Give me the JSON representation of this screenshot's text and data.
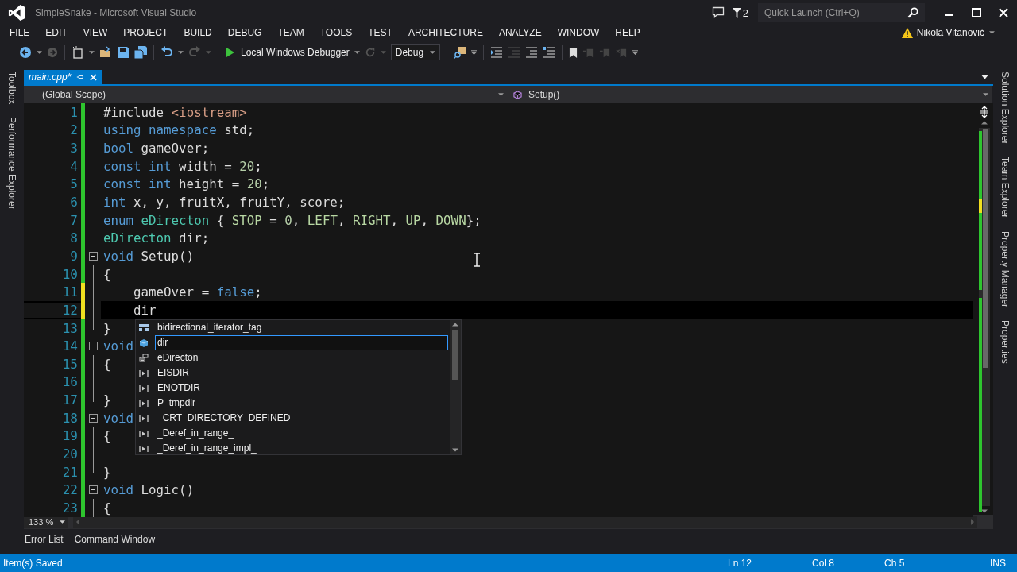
{
  "window": {
    "title": "SimpleSnake - Microsoft Visual Studio"
  },
  "title_bar": {
    "notification_count": "2",
    "quick_launch": {
      "placeholder": "Quick Launch (Ctrl+Q)"
    }
  },
  "menu": [
    {
      "label": "FILE"
    },
    {
      "label": "EDIT"
    },
    {
      "label": "VIEW"
    },
    {
      "label": "PROJECT"
    },
    {
      "label": "BUILD"
    },
    {
      "label": "DEBUG"
    },
    {
      "label": "TEAM"
    },
    {
      "label": "TOOLS"
    },
    {
      "label": "TEST"
    },
    {
      "label": "ARCHITECTURE"
    },
    {
      "label": "ANALYZE"
    },
    {
      "label": "WINDOW"
    },
    {
      "label": "HELP"
    }
  ],
  "account": {
    "name": "Nikola Vitanović"
  },
  "toolbar": {
    "debugger": "Local Windows Debugger",
    "configuration": "Debug"
  },
  "left_panel_tabs": [
    {
      "label": "Toolbox"
    },
    {
      "label": "Performance Explorer"
    }
  ],
  "right_panel_tabs": [
    {
      "label": "Solution Explorer"
    },
    {
      "label": "Team Explorer"
    },
    {
      "label": "Property Manager"
    },
    {
      "label": "Properties"
    }
  ],
  "document_tabs": [
    {
      "label": "main.cpp*",
      "selected": true
    }
  ],
  "navigation_bar": {
    "scope": "(Global Scope)",
    "member": "Setup()"
  },
  "editor": {
    "zoom": "133 %",
    "lines": [
      {
        "number": "1",
        "modified": false,
        "kind": "plain",
        "current": false,
        "tokens": [
          {
            "text": "#include ",
            "kind": "plain"
          },
          {
            "text": "<iostream>",
            "kind": "string"
          }
        ]
      },
      {
        "number": "2",
        "modified": false,
        "kind": "plain",
        "current": false,
        "tokens": [
          {
            "text": "using namespace ",
            "kind": "keyword"
          },
          {
            "text": "std;",
            "kind": "plain"
          }
        ]
      },
      {
        "number": "3",
        "modified": false,
        "kind": "plain",
        "current": false,
        "tokens": [
          {
            "text": "bool ",
            "kind": "keyword"
          },
          {
            "text": "gameOver;",
            "kind": "plain"
          }
        ]
      },
      {
        "number": "4",
        "modified": false,
        "kind": "plain",
        "current": false,
        "tokens": [
          {
            "text": "const int ",
            "kind": "keyword"
          },
          {
            "text": "width = ",
            "kind": "plain"
          },
          {
            "text": "20",
            "kind": "number"
          },
          {
            "text": ";",
            "kind": "plain"
          }
        ]
      },
      {
        "number": "5",
        "modified": false,
        "kind": "plain",
        "current": false,
        "tokens": [
          {
            "text": "const int ",
            "kind": "keyword"
          },
          {
            "text": "height = ",
            "kind": "plain"
          },
          {
            "text": "20",
            "kind": "number"
          },
          {
            "text": ";",
            "kind": "plain"
          }
        ]
      },
      {
        "number": "6",
        "modified": false,
        "kind": "plain",
        "current": false,
        "tokens": [
          {
            "text": "int ",
            "kind": "keyword"
          },
          {
            "text": "x, y, fruitX, fruitY, score;",
            "kind": "plain"
          }
        ]
      },
      {
        "number": "7",
        "modified": false,
        "kind": "plain",
        "current": false,
        "tokens": [
          {
            "text": "enum ",
            "kind": "keyword"
          },
          {
            "text": "eDirecton",
            "kind": "type"
          },
          {
            "text": " { ",
            "kind": "plain"
          },
          {
            "text": "STOP",
            "kind": "enumerator"
          },
          {
            "text": " = ",
            "kind": "plain"
          },
          {
            "text": "0",
            "kind": "number"
          },
          {
            "text": ", ",
            "kind": "plain"
          },
          {
            "text": "LEFT",
            "kind": "enumerator"
          },
          {
            "text": ", ",
            "kind": "plain"
          },
          {
            "text": "RIGHT",
            "kind": "enumerator"
          },
          {
            "text": ", ",
            "kind": "plain"
          },
          {
            "text": "UP",
            "kind": "enumerator"
          },
          {
            "text": ", ",
            "kind": "plain"
          },
          {
            "text": "DOWN",
            "kind": "enumerator"
          },
          {
            "text": "};",
            "kind": "plain"
          }
        ]
      },
      {
        "number": "8",
        "modified": false,
        "kind": "plain",
        "current": false,
        "tokens": [
          {
            "text": "eDirecton",
            "kind": "type"
          },
          {
            "text": " dir;",
            "kind": "plain"
          }
        ]
      },
      {
        "number": "9",
        "modified": false,
        "kind": "block_start",
        "current": false,
        "tokens": [
          {
            "text": "void ",
            "kind": "keyword"
          },
          {
            "text": "Setup()",
            "kind": "plain"
          }
        ]
      },
      {
        "number": "10",
        "modified": false,
        "kind": "block_body",
        "current": false,
        "tokens": [
          {
            "text": "{",
            "kind": "plain"
          }
        ]
      },
      {
        "number": "11",
        "modified": true,
        "kind": "block_body",
        "current": false,
        "tokens": [
          {
            "text": "    gameOver = ",
            "kind": "plain"
          },
          {
            "text": "false",
            "kind": "keyword"
          },
          {
            "text": ";",
            "kind": "plain"
          }
        ]
      },
      {
        "number": "12",
        "modified": true,
        "kind": "block_body",
        "current": true,
        "tokens": [
          {
            "text": "    dir",
            "kind": "plain"
          }
        ]
      },
      {
        "number": "13",
        "modified": false,
        "kind": "block_end",
        "current": false,
        "tokens": [
          {
            "text": "}",
            "kind": "plain"
          }
        ]
      },
      {
        "number": "14",
        "modified": false,
        "kind": "block_start",
        "current": false,
        "tokens": [
          {
            "text": "void",
            "kind": "keyword"
          }
        ]
      },
      {
        "number": "15",
        "modified": false,
        "kind": "block_body",
        "current": false,
        "tokens": [
          {
            "text": "{",
            "kind": "plain"
          }
        ]
      },
      {
        "number": "16",
        "modified": false,
        "kind": "block_body",
        "current": false
      },
      {
        "number": "17",
        "modified": false,
        "kind": "block_end",
        "current": false,
        "tokens": [
          {
            "text": "}",
            "kind": "plain"
          }
        ]
      },
      {
        "number": "18",
        "modified": false,
        "kind": "block_start",
        "current": false,
        "tokens": [
          {
            "text": "void",
            "kind": "keyword"
          }
        ]
      },
      {
        "number": "19",
        "modified": false,
        "kind": "block_body",
        "current": false,
        "tokens": [
          {
            "text": "{",
            "kind": "plain"
          }
        ]
      },
      {
        "number": "20",
        "modified": false,
        "kind": "block_body",
        "current": false
      },
      {
        "number": "21",
        "modified": false,
        "kind": "block_end",
        "current": false,
        "tokens": [
          {
            "text": "}",
            "kind": "plain"
          }
        ]
      },
      {
        "number": "22",
        "modified": false,
        "kind": "block_start",
        "current": false,
        "tokens": [
          {
            "text": "void ",
            "kind": "keyword"
          },
          {
            "text": "Logic()",
            "kind": "plain"
          }
        ]
      },
      {
        "number": "23",
        "modified": false,
        "kind": "block_body",
        "current": false,
        "tokens": [
          {
            "text": "{",
            "kind": "plain"
          }
        ]
      }
    ]
  },
  "completion_list": {
    "items": [
      {
        "label": "bidirectional_iterator_tag",
        "kind": "struct",
        "selected": false
      },
      {
        "label": "dir",
        "kind": "variable",
        "selected": true
      },
      {
        "label": "eDirecton",
        "kind": "enum",
        "selected": false
      },
      {
        "label": "EISDIR",
        "kind": "macro",
        "selected": false
      },
      {
        "label": "ENOTDIR",
        "kind": "macro",
        "selected": false
      },
      {
        "label": "P_tmpdir",
        "kind": "macro",
        "selected": false
      },
      {
        "label": "_CRT_DIRECTORY_DEFINED",
        "kind": "macro",
        "selected": false
      },
      {
        "label": "_Deref_in_range_",
        "kind": "macro",
        "selected": false
      },
      {
        "label": "_Deref_in_range_impl_",
        "kind": "macro",
        "selected": false
      }
    ]
  },
  "tool_tabs": [
    {
      "label": "Error List"
    },
    {
      "label": "Command Window"
    }
  ],
  "status_bar": {
    "message": "Item(s) Saved",
    "line": "Ln 12",
    "column": "Col 8",
    "character": "Ch 5",
    "mode": "INS"
  }
}
